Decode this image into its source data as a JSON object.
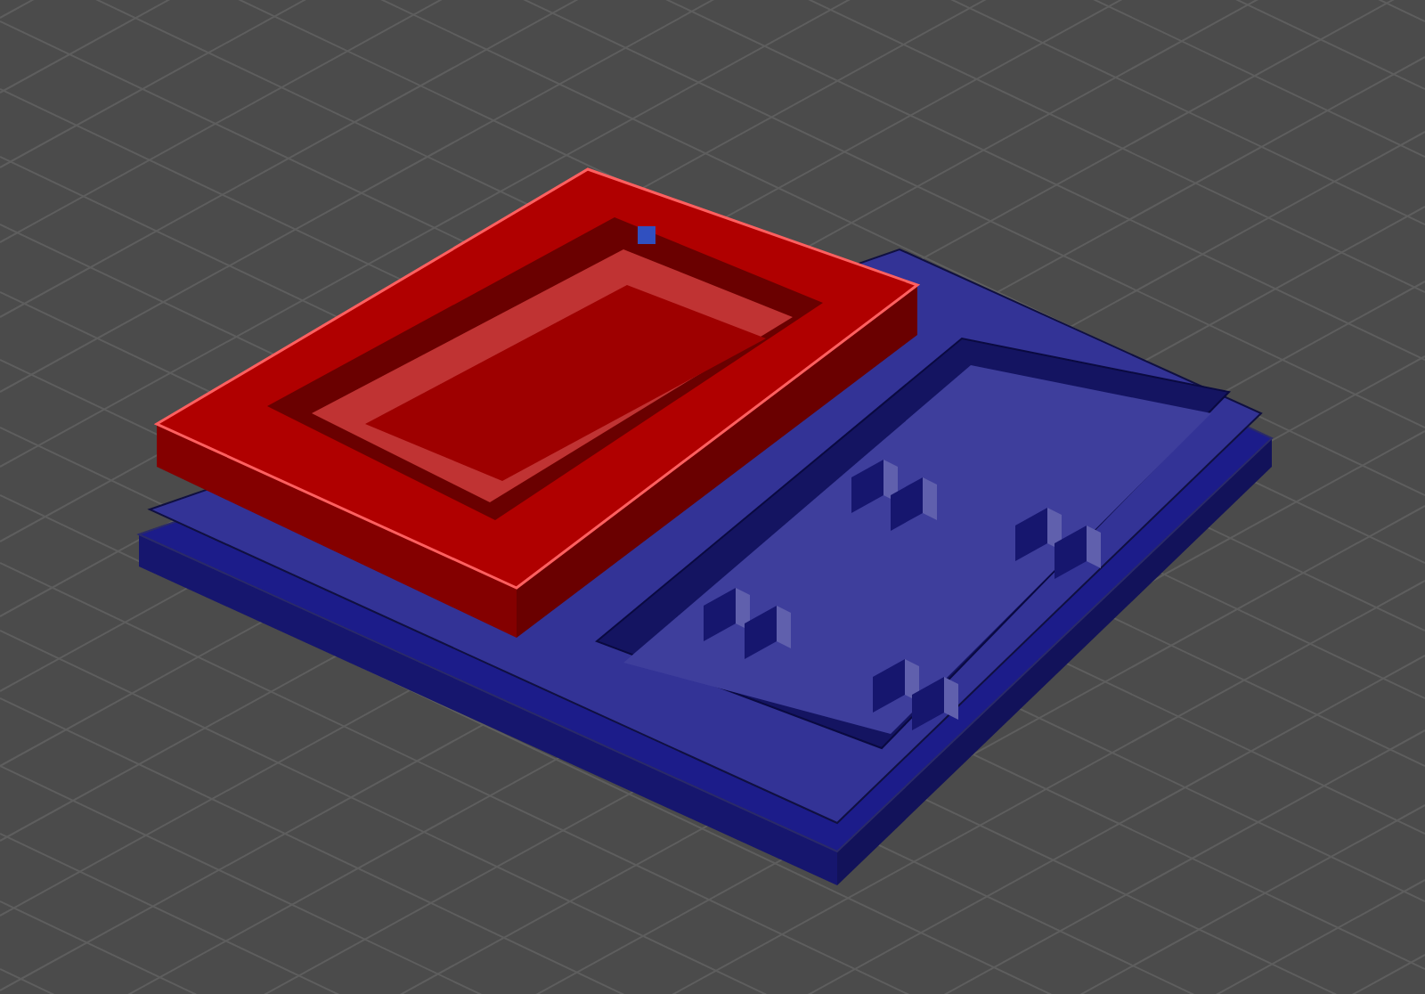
{
  "viewport": {
    "grid": true,
    "parts": [
      {
        "kind": "tray",
        "color": "#1c1c8a"
      },
      {
        "kind": "frame",
        "color": "#b00000"
      }
    ]
  }
}
